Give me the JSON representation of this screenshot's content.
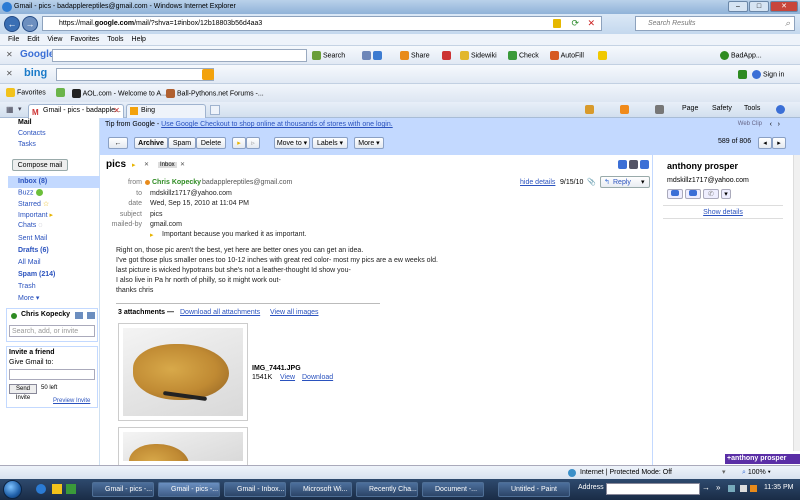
{
  "window": {
    "title": "Gmail - pics - badapplereptiles@gmail.com - Windows Internet Explorer"
  },
  "address": {
    "url_prefix": "https://mail.",
    "url_domain": "google.com",
    "url_rest": "/mail/?shva=1#inbox/12b18803b56d4aa3",
    "search_placeholder": "Search Results"
  },
  "menu": [
    "File",
    "Edit",
    "View",
    "Favorites",
    "Tools",
    "Help"
  ],
  "google_toolbar": {
    "logo": "Google",
    "search": "Search",
    "share": "Share",
    "sidewiki": "Sidewiki",
    "check": "Check",
    "autofill": "AutoFill",
    "user": "BadApp..."
  },
  "bing_toolbar": {
    "logo": "bing",
    "signin": "Sign in"
  },
  "favorites": {
    "label": "Favorites",
    "items": [
      "AOL.com - Welcome to A...",
      "Ball-Pythons.net Forums -..."
    ]
  },
  "tabs": [
    "Gmail - pics - badapple...",
    "Bing"
  ],
  "ie_cmds": {
    "page": "Page",
    "safety": "Safety",
    "tools": "Tools"
  },
  "nav": {
    "mail": "Mail",
    "contacts": "Contacts",
    "tasks": "Tasks",
    "compose": "Compose mail",
    "items": [
      "Inbox (8)",
      "Buzz",
      "Starred",
      "Important",
      "Chats",
      "Sent Mail",
      "Drafts (6)",
      "All Mail",
      "Spam (214)",
      "Trash",
      "More ▾"
    ],
    "chat_user": "Chris Kopecky",
    "chat_search": "Search, add, or invite",
    "invite_title": "Invite a friend",
    "invite_sub": "Give Gmail to:",
    "invite_btn": "Send Invite",
    "invite_left": "50 left",
    "preview_invite": "Preview Invite"
  },
  "tip": {
    "prefix": "Tip from Google - ",
    "link": "Use Google Checkout to shop online at thousands of stores with one login.",
    "webclip": "Web Clip"
  },
  "actions": {
    "archive": "Archive",
    "spam": "Spam",
    "delete": "Delete",
    "moveto": "Move to ▾",
    "labels": "Labels ▾",
    "more": "More ▾",
    "count": "589 of 806"
  },
  "message": {
    "subject": "pics",
    "inbox_tag": "Inbox",
    "from_label": "from",
    "from_name": "Chris Kopecky",
    "from_email": "badapplereptiles@gmail.com",
    "hide_details": "hide details",
    "date_short": "9/15/10",
    "reply": "Reply",
    "to_label": "to",
    "to_value": "mdskillz1717@yahoo.com",
    "date_label": "date",
    "date_value": "Wed, Sep 15, 2010 at 11:04 PM",
    "subject_label": "subject",
    "subject_value": "pics",
    "mailedby_label": "mailed-by",
    "mailedby_value": "gmail.com",
    "important_note": "Important because you marked it as important.",
    "body": [
      "Right on, those pic aren't the best, yet here are better ones you can get an idea.",
      "I've got those plus smaller ones too 10-12 inches with great red color- most my pics are a ew weeks old.",
      " last picture is wicked hypotrans but she's not a leather-thought Id show you-",
      "I also live in Pa hr north of philly, so it might work out-",
      "thanks chris"
    ],
    "attachments_title": "3 attachments — ",
    "download_all": "Download all attachments",
    "view_all": "View all images",
    "att1": {
      "name": "IMG_7441.JPG",
      "size": "1541K",
      "view": "View",
      "download": "Download"
    }
  },
  "contact": {
    "name": "anthony prosper",
    "email": "mdskillz1717@yahoo.com",
    "show_details": "Show details",
    "chat_tab": "+anthony prosper"
  },
  "status": {
    "zone": "Internet | Protected Mode: Off",
    "zoom": "100%"
  },
  "taskbar": {
    "items": [
      "Gmail - pics -...",
      "Gmail - pics -...",
      "Gmail - Inbox...",
      "Microsoft Wi...",
      "Recently Cha...",
      "Document -...",
      "Untitled - Paint"
    ],
    "address": "Address",
    "clock": "11:35 PM"
  },
  "colors": {
    "gmail_blue": "#c3d9ff",
    "link": "#2a52be",
    "green": "#2e8b22"
  }
}
